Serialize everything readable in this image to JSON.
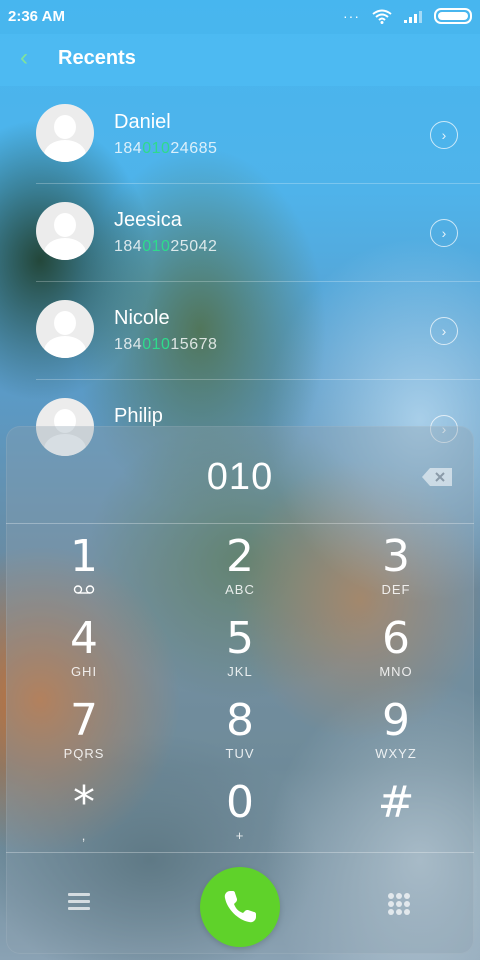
{
  "status_bar": {
    "time": "2:36 AM",
    "dots": "···"
  },
  "header": {
    "back_icon": "‹",
    "title": "Recents"
  },
  "contacts": [
    {
      "name": "Daniel",
      "number_prefix": "184",
      "number_match": "010",
      "number_suffix": "24685"
    },
    {
      "name": "Jeesica",
      "number_prefix": "184",
      "number_match": "010",
      "number_suffix": "25042"
    },
    {
      "name": "Nicole",
      "number_prefix": "184",
      "number_match": "010",
      "number_suffix": "15678"
    },
    {
      "name": "Philip",
      "number_prefix": "",
      "number_match": "",
      "number_suffix": ""
    }
  ],
  "dialer": {
    "input": "010",
    "keys": [
      {
        "digit": "1",
        "letters": "ꝏ"
      },
      {
        "digit": "2",
        "letters": "ABC"
      },
      {
        "digit": "3",
        "letters": "DEF"
      },
      {
        "digit": "4",
        "letters": "GHI"
      },
      {
        "digit": "5",
        "letters": "JKL"
      },
      {
        "digit": "6",
        "letters": "MNO"
      },
      {
        "digit": "7",
        "letters": "PQRS"
      },
      {
        "digit": "8",
        "letters": "TUV"
      },
      {
        "digit": "9",
        "letters": "WXYZ"
      },
      {
        "digit": "*",
        "letters": ","
      },
      {
        "digit": "0",
        "letters": "+"
      },
      {
        "digit": "#",
        "letters": ""
      }
    ]
  },
  "colors": {
    "match_highlight": "#2edb8c",
    "call_button": "#5fd22a",
    "back_arrow": "#7fe39c"
  },
  "icons": {
    "back": "back-arrow-icon",
    "wifi": "wifi-icon",
    "signal": "signal-icon",
    "battery": "battery-icon",
    "chevron": "chevron-right-icon",
    "backspace": "backspace-icon",
    "menu": "menu-icon",
    "call": "phone-icon",
    "keypad": "keypad-icon",
    "voicemail": "voicemail-icon"
  }
}
